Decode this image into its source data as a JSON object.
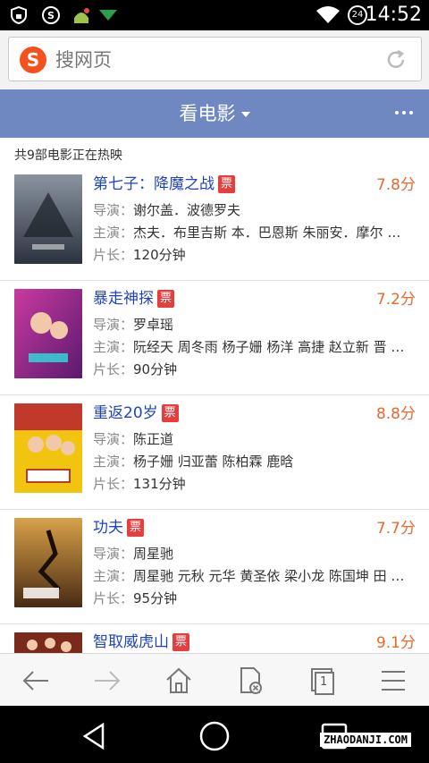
{
  "status_bar": {
    "time": "14:52",
    "notification_badge": "24",
    "icons": [
      "shield-lock-icon",
      "sogou-s-icon",
      "android-app-icon",
      "download-arrow-icon",
      "wifi-icon"
    ]
  },
  "url_bar": {
    "logo": "S",
    "placeholder": "搜网页"
  },
  "title_bar": {
    "title": "看电影"
  },
  "summary": "共9部电影正在热映",
  "labels": {
    "director": "导演：",
    "cast": "主演：",
    "length": "片长："
  },
  "movies": [
    {
      "title": "第七子：降魔之战",
      "ticket": "票",
      "rating": "7.8分",
      "director": "谢尔盖．波德罗夫",
      "cast": "杰夫．布里吉斯 本．巴恩斯 朱丽安．摩尔 …",
      "length": "120分钟",
      "poster_colors": [
        "#2b3340",
        "#8a94a0"
      ]
    },
    {
      "title": "暴走神探",
      "ticket": "票",
      "rating": "7.2分",
      "director": "罗卓瑶",
      "cast": "阮经天 周冬雨 杨子姗 杨洋 高捷 赵立新 晋 …",
      "length": "90分钟",
      "poster_colors": [
        "#5a1a6e",
        "#c93aa0"
      ]
    },
    {
      "title": "重返20岁",
      "ticket": "票",
      "rating": "8.8分",
      "director": "陈正道",
      "cast": "杨子姗 归亚蕾 陈柏霖 鹿晗",
      "length": "131分钟",
      "poster_colors": [
        "#c0392b",
        "#f1c40f"
      ]
    },
    {
      "title": "功夫",
      "ticket": "票",
      "rating": "7.7分",
      "director": "周星驰",
      "cast": "周星驰 元秋 元华 黄圣依 梁小龙 陈国坤 田 …",
      "length": "95分钟",
      "poster_colors": [
        "#4a2a12",
        "#d8a24a"
      ]
    },
    {
      "title": "智取威虎山",
      "ticket": "票",
      "rating": "9.1分",
      "director": "",
      "cast": "",
      "length": "",
      "poster_colors": [
        "#7a2a1a",
        "#c98a4a"
      ]
    }
  ],
  "toolbar": {
    "buttons": [
      "back-icon",
      "forward-icon",
      "home-icon",
      "close-page-icon",
      "tabs-icon",
      "menu-icon"
    ],
    "tab_count": "1"
  },
  "navbar": {
    "buttons": [
      "nav-back-icon",
      "nav-home-icon",
      "nav-recent-icon"
    ]
  },
  "watermark": "ZHAODANJI.COM",
  "colors": {
    "title_bar": "#6f88c2",
    "movie_title": "#2244bb",
    "rating": "#e86a2a",
    "ticket": "#e53e3e",
    "logo": "#f4511e"
  }
}
